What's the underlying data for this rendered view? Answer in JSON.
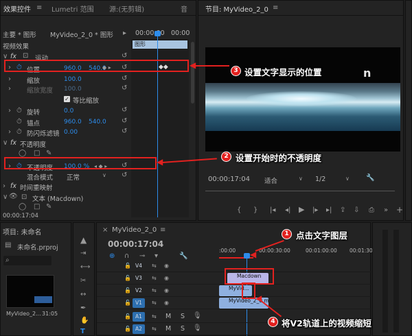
{
  "effect_controls": {
    "tabs": [
      "效果控件",
      "Lumetri 范围",
      "源:(无剪辑)",
      "音"
    ],
    "header_main": "主要 * 图形",
    "header_clip": "MyVideo_2_0 * 图形",
    "timecode_mini": "00:00:00",
    "timecode_mini2": "00:00",
    "clip_bar_label": "图形",
    "section_video": "视频效果",
    "motion": "运动",
    "position_label": "位置",
    "position_x": "960.0",
    "position_y": "540.0",
    "scale_label": "缩放",
    "scale_value": "100.0",
    "scale_width_label": "缩放宽度",
    "scale_width_value": "100.0",
    "uniform_scale": "等比缩放",
    "rotation_label": "旋转",
    "rotation_value": "0.0",
    "anchor_label": "锚点",
    "anchor_x": "960.0",
    "anchor_y": "540.0",
    "flicker_label": "防闪烁滤镜",
    "flicker_value": "0.00",
    "opacity_section": "不透明度",
    "opacity_label": "不透明度",
    "opacity_value": "100.0 %",
    "blend_label": "混合模式",
    "blend_value": "正常",
    "time_remap": "时间重映射",
    "text_layer": "文本 (Macdown)",
    "footer_timecode": "00:00:17:04"
  },
  "program": {
    "title": "节目: MyVideo_2_0",
    "timecode": "00:00:17:04",
    "fit": "适合",
    "resolution": "1/2",
    "overlay_text": "n"
  },
  "project": {
    "title": "项目: 未命名",
    "file": "未命名.prproj",
    "clip_name": "MyVideo_2...",
    "clip_duration": "31:05"
  },
  "timeline": {
    "title": "MyVideo_2_0",
    "timecode": "00:00:17:04",
    "ruler": [
      ":00:00",
      "00:00:30:00",
      "00:01:00:00",
      "00:01:30:00"
    ],
    "tracks_video": [
      "V4",
      "V3",
      "V2",
      "V1"
    ],
    "tracks_audio": [
      "A1",
      "A2"
    ],
    "clip_text": "Macdown",
    "clip_v2": "MyVid...",
    "clip_v1": "MyVideo_2_0.m",
    "mute": "M",
    "solo": "S"
  },
  "annotations": {
    "a1": "点击文字图层",
    "a2": "设置开始时的不透明度",
    "a3": "设置文字显示的位置",
    "a4": "将V2轨道上的视频缩短",
    "n1": "1",
    "n2": "2",
    "n3": "3",
    "n4": "4"
  },
  "colors": {
    "accent": "#2d8ceb",
    "annotation": "#e3211f",
    "panel": "#232323"
  }
}
